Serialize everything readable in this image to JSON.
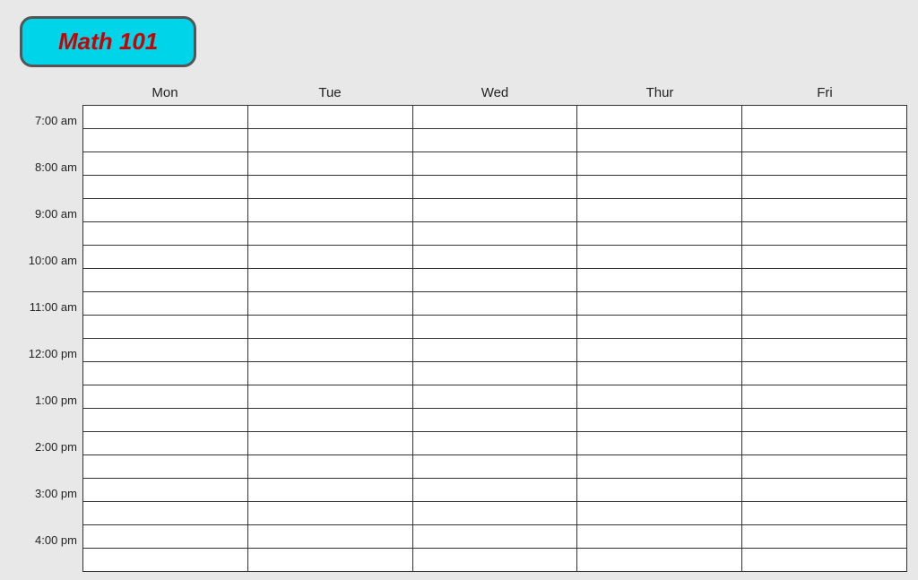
{
  "title": "Math 101",
  "days": [
    "Mon",
    "Tue",
    "Wed",
    "Thur",
    "Fri"
  ],
  "time_slots": [
    "7:00 am",
    "8:00 am",
    "9:00 am",
    "10:00 am",
    "11:00 am",
    "12:00 pm",
    "1:00 pm",
    "2:00 pm",
    "3:00 pm",
    "4:00 pm"
  ],
  "colors": {
    "badge_bg": "#00d4e8",
    "badge_border": "#555555",
    "title_text": "#cc0000",
    "grid_border": "#333333",
    "cell_bg": "#ffffff",
    "page_bg": "#e8e8e8"
  }
}
